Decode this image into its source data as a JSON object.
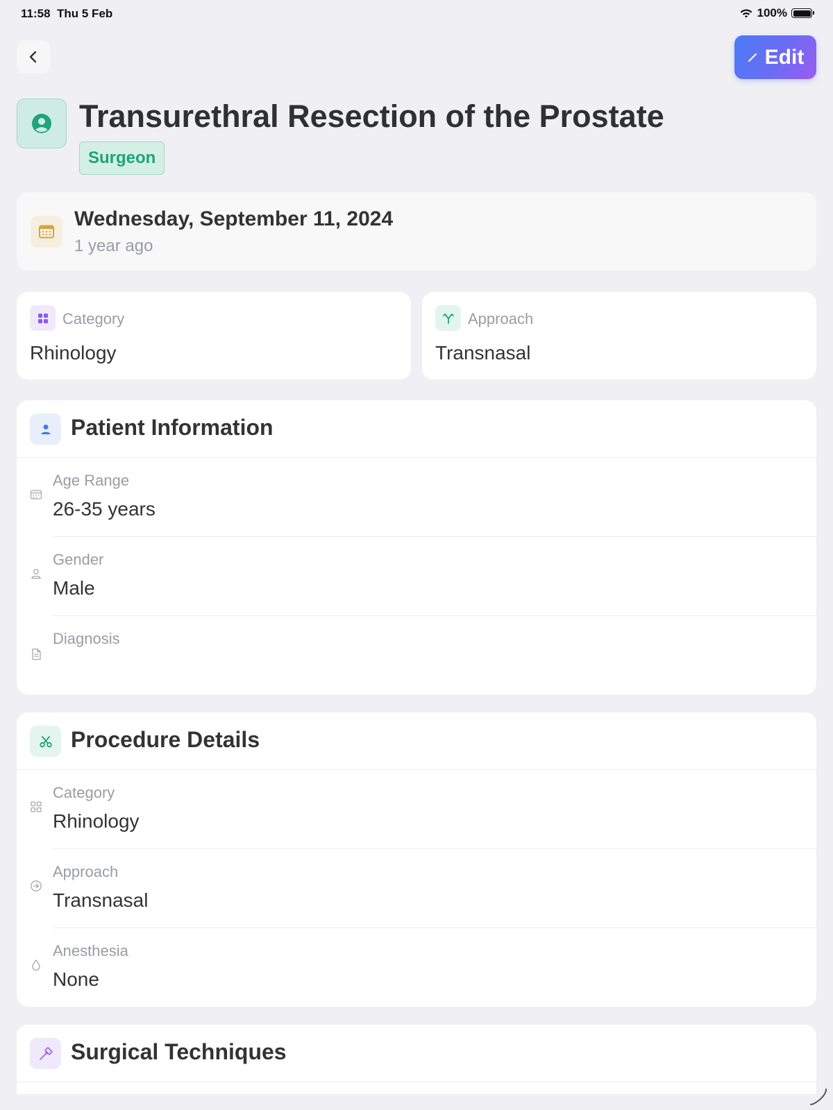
{
  "status_bar": {
    "time": "11:58",
    "date": "Thu 5 Feb",
    "battery": "100%"
  },
  "nav": {
    "edit_label": "Edit"
  },
  "header": {
    "title": "Transurethral Resection of the Prostate",
    "role": "Surgeon"
  },
  "date_card": {
    "date": "Wednesday, September 11, 2024",
    "relative": "1 year ago"
  },
  "summary": {
    "category": {
      "label": "Category",
      "value": "Rhinology"
    },
    "approach": {
      "label": "Approach",
      "value": "Transnasal"
    }
  },
  "patient_info": {
    "title": "Patient Information",
    "fields": [
      {
        "label": "Age Range",
        "value": "26-35 years"
      },
      {
        "label": "Gender",
        "value": "Male"
      },
      {
        "label": "Diagnosis",
        "value": ""
      }
    ]
  },
  "procedure_details": {
    "title": "Procedure Details",
    "fields": [
      {
        "label": "Category",
        "value": "Rhinology"
      },
      {
        "label": "Approach",
        "value": "Transnasal"
      },
      {
        "label": "Anesthesia",
        "value": "None"
      }
    ]
  },
  "surgical_techniques": {
    "title": "Surgical Techniques"
  },
  "colors": {
    "accent_green": "#1ea37a",
    "accent_blue": "#4a7cf6",
    "accent_purple": "#9a5cf2",
    "date_gold": "#d4a63a"
  },
  "icons": [
    "back-chevron-icon",
    "pencil-icon",
    "user-circle-icon",
    "calendar-icon",
    "grid-icon",
    "fork-icon",
    "user-icon",
    "person-outline-icon",
    "document-icon",
    "scissors-icon",
    "arrow-circle-icon",
    "droplet-icon",
    "hammer-icon",
    "wifi-icon",
    "battery-icon"
  ]
}
